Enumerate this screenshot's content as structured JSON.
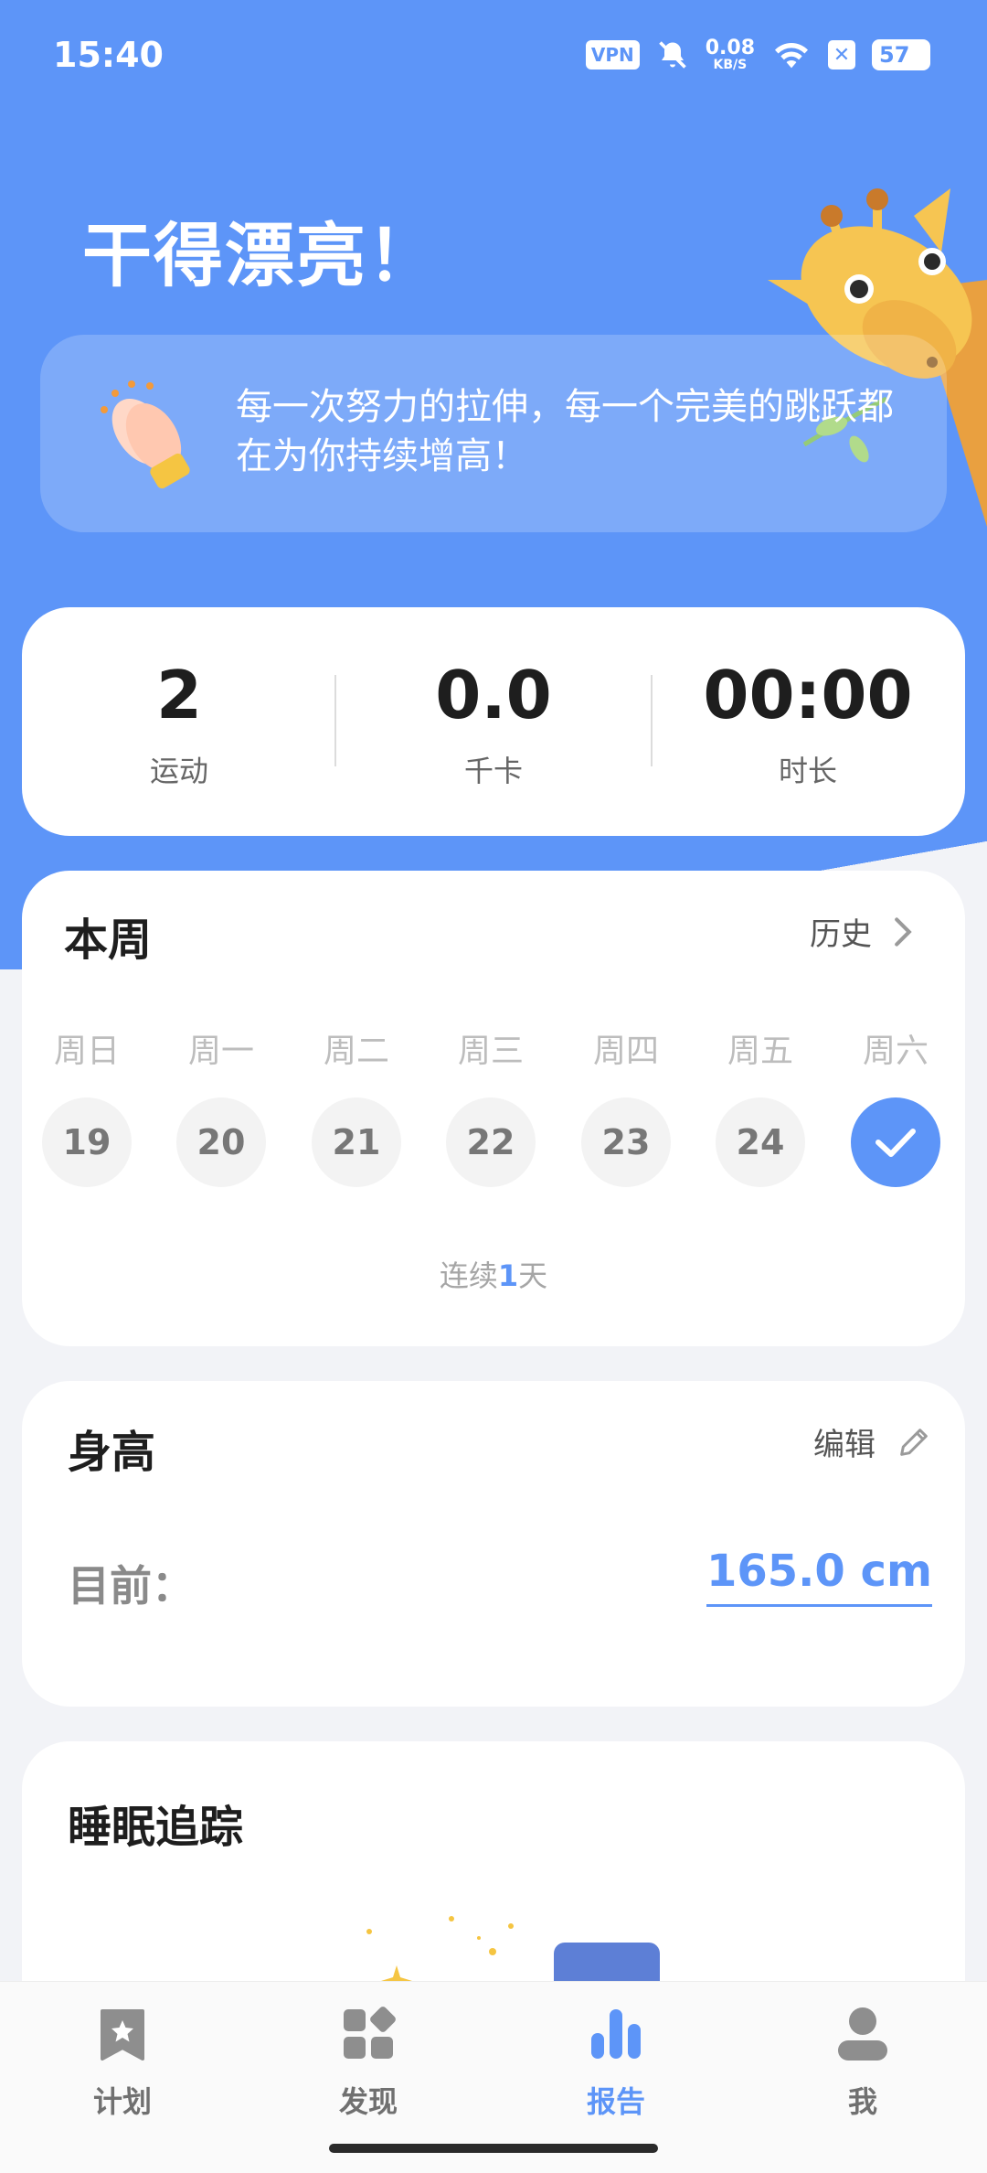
{
  "status_bar": {
    "time": "15:40",
    "vpn": "VPN",
    "net_speed_value": "0.08",
    "net_speed_unit": "KB/S",
    "battery": "57",
    "icons": [
      "vpn-icon",
      "bell-mute-icon",
      "wifi-icon",
      "sim-off-icon",
      "battery-icon"
    ]
  },
  "header": {
    "title": "干得漂亮！",
    "motto": "每一次努力的拉伸，每一个完美的跳跃都在为你持续增高！"
  },
  "stats": [
    {
      "value": "2",
      "label": "运动"
    },
    {
      "value": "0.0",
      "label": "千卡"
    },
    {
      "value": "00:00",
      "label": "时长"
    }
  ],
  "week": {
    "title": "本周",
    "history_label": "历史",
    "days": [
      {
        "label": "周日",
        "date": "19",
        "done": false
      },
      {
        "label": "周一",
        "date": "20",
        "done": false
      },
      {
        "label": "周二",
        "date": "21",
        "done": false
      },
      {
        "label": "周三",
        "date": "22",
        "done": false
      },
      {
        "label": "周四",
        "date": "23",
        "done": false
      },
      {
        "label": "周五",
        "date": "24",
        "done": false
      },
      {
        "label": "周六",
        "date": "",
        "done": true
      }
    ],
    "streak_prefix": "连续",
    "streak_count": "1",
    "streak_suffix": "天"
  },
  "height": {
    "title": "身高",
    "edit_label": "编辑",
    "current_label": "目前：",
    "current_value": "165.0 cm"
  },
  "sleep": {
    "title": "睡眠追踪"
  },
  "tabbar": {
    "active": "报告",
    "tabs": [
      {
        "label": "计划",
        "icon": "bookmark-star-icon"
      },
      {
        "label": "发现",
        "icon": "grid-icon"
      },
      {
        "label": "报告",
        "icon": "bar-chart-icon"
      },
      {
        "label": "我",
        "icon": "person-icon"
      }
    ]
  },
  "colors": {
    "primary": "#5D95F8",
    "background": "#F2F3F7",
    "card": "#FFFFFF"
  }
}
